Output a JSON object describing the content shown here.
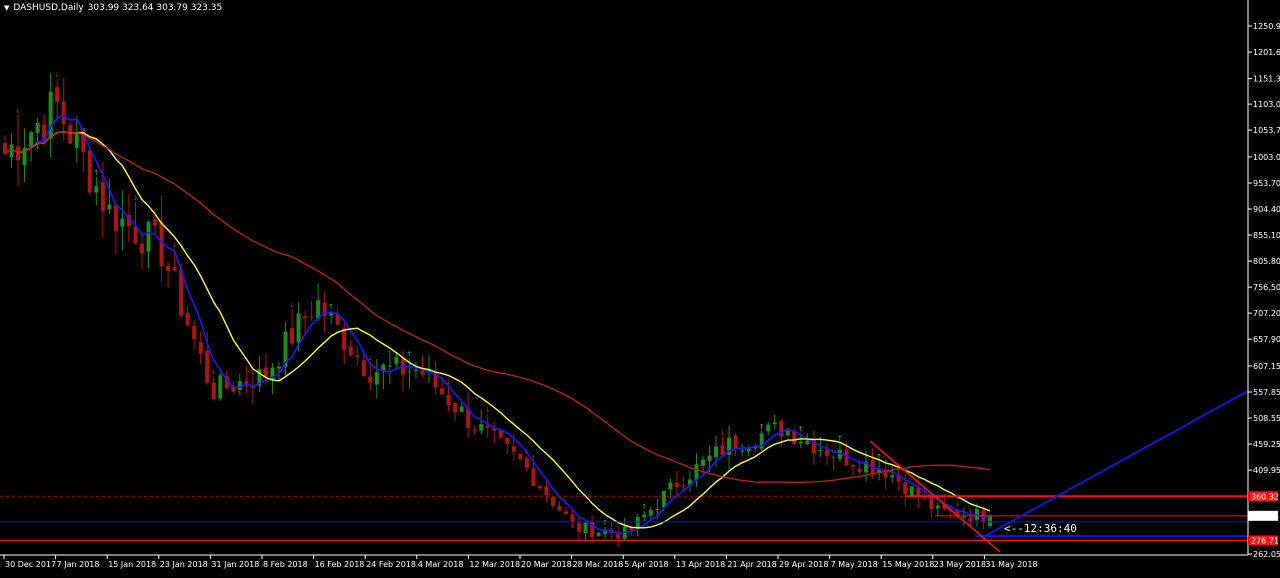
{
  "header": {
    "symbol_period": "DASHUSD,Daily",
    "ohlc": "303.99 323.64 303.79 323.35"
  },
  "countdown": "<--12:36:40",
  "colors": {
    "background": "#000000",
    "bull": "#1e8c1e",
    "bear": "#b01515",
    "ma_fast": "#1a1aff",
    "ma_mid": "#ffff33",
    "ma_slow": "#c02020",
    "trend_blue": "#1515dd",
    "support_red": "#ff1010",
    "price_label_bg": "#ffffff"
  },
  "price_axis": {
    "labels": [
      "1250.95",
      "1201.65",
      "1151.35",
      "1103.05",
      "1053.75",
      "1003.00",
      "953.70",
      "904.40",
      "855.10",
      "805.80",
      "756.50",
      "707.20",
      "657.90",
      "607.15",
      "557.85",
      "508.55",
      "459.25",
      "409.95",
      "262.05"
    ]
  },
  "price_tags": [
    {
      "text": "360.32",
      "value": 360.32,
      "style": "red"
    },
    {
      "text": "323.35",
      "value": 323.35,
      "style": "white"
    },
    {
      "text": "276.71",
      "value": 276.71,
      "style": "red"
    }
  ],
  "time_axis": {
    "labels": [
      "30 Dec 2017",
      "7 Jan 2018",
      "15 Jan 2018",
      "23 Jan 2018",
      "31 Jan 2018",
      "8 Feb 2018",
      "16 Feb 2018",
      "24 Feb 2018",
      "4 Mar 2018",
      "12 Mar 2018",
      "20 Mar 2018",
      "28 Mar 2018",
      "5 Apr 2018",
      "13 Apr 2018",
      "21 Apr 2018",
      "29 Apr 2018",
      "7 May 2018",
      "15 May 2018",
      "23 May 2018",
      "31 May 2018"
    ]
  },
  "chart_data": {
    "type": "candlestick",
    "title": "DASHUSD,Daily",
    "y_range": [
      245,
      1275
    ],
    "key_prices": [
      {
        "date": "30 Dec 2017",
        "price": 1010
      },
      {
        "date": "7 Jan 2018",
        "price": 1100
      },
      {
        "date": "15 Jan 2018",
        "price": 900
      },
      {
        "date": "23 Jan 2018",
        "price": 830
      },
      {
        "date": "31 Jan 2018",
        "price": 560
      },
      {
        "date": "8 Feb 2018",
        "price": 590
      },
      {
        "date": "16 Feb 2018",
        "price": 730
      },
      {
        "date": "24 Feb 2018",
        "price": 600
      },
      {
        "date": "4 Mar 2018",
        "price": 600
      },
      {
        "date": "12 Mar 2018",
        "price": 500
      },
      {
        "date": "20 Mar 2018",
        "price": 420
      },
      {
        "date": "28 Mar 2018",
        "price": 300
      },
      {
        "date": "5 Apr 2018",
        "price": 290
      },
      {
        "date": "13 Apr 2018",
        "price": 390
      },
      {
        "date": "21 Apr 2018",
        "price": 460
      },
      {
        "date": "29 Apr 2018",
        "price": 490
      },
      {
        "date": "7 May 2018",
        "price": 440
      },
      {
        "date": "15 May 2018",
        "price": 410
      },
      {
        "date": "23 May 2018",
        "price": 330
      },
      {
        "date": "31 May 2018",
        "price": 323.35
      }
    ],
    "last_ohlc": {
      "open": 303.99,
      "high": 323.64,
      "low": 303.79,
      "close": 323.35
    },
    "horizontal_lines": [
      {
        "price": 360.32,
        "color": "red"
      },
      {
        "price": 323.35,
        "color": "blue"
      },
      {
        "price": 276.71,
        "color": "red"
      }
    ]
  }
}
